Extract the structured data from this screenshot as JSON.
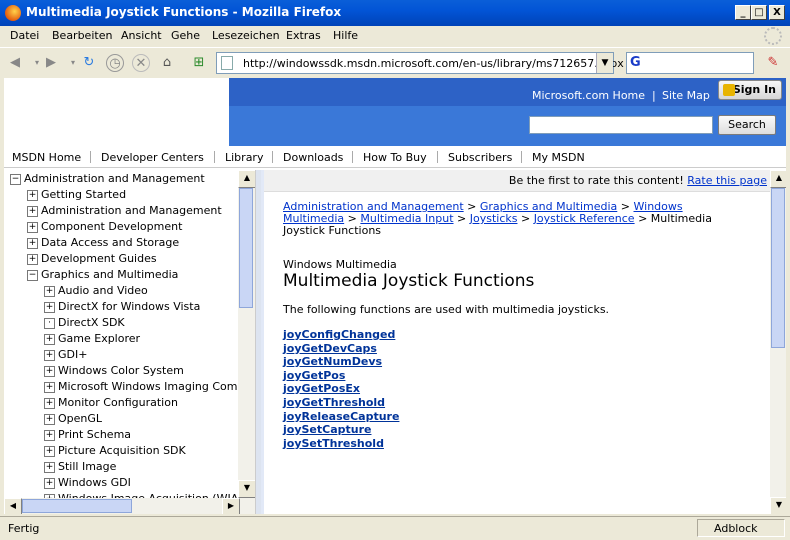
{
  "window": {
    "title": "Multimedia Joystick Functions - Mozilla Firefox",
    "min_label": "_",
    "max_label": "□",
    "close_label": "X"
  },
  "menu": {
    "items": [
      "Datei",
      "Bearbeiten",
      "Ansicht",
      "Gehe",
      "Lesezeichen",
      "Extras",
      "Hilfe"
    ]
  },
  "toolbar": {
    "url": "http://windowssdk.msdn.microsoft.com/en-us/library/ms712657.aspx",
    "search_engine_glyph": "G"
  },
  "header": {
    "link_home": "Microsoft.com Home",
    "link_sep": "|",
    "link_sitemap": "Site Map",
    "signin_label": "Sign In",
    "search_button": "Search",
    "search_value": ""
  },
  "nav": {
    "items": [
      "MSDN Home",
      "Developer Centers",
      "Library",
      "Downloads",
      "How To Buy",
      "Subscribers",
      "My MSDN"
    ]
  },
  "tree": {
    "nodes": [
      {
        "label": "Administration and Management",
        "level": 0,
        "state": "−"
      },
      {
        "label": "Getting Started",
        "level": 1,
        "state": "+"
      },
      {
        "label": "Administration and Management",
        "level": 1,
        "state": "+"
      },
      {
        "label": "Component Development",
        "level": 1,
        "state": "+"
      },
      {
        "label": "Data Access and Storage",
        "level": 1,
        "state": "+"
      },
      {
        "label": "Development Guides",
        "level": 1,
        "state": "+"
      },
      {
        "label": "Graphics and Multimedia",
        "level": 1,
        "state": "−"
      },
      {
        "label": "Audio and Video",
        "level": 2,
        "state": "+"
      },
      {
        "label": "DirectX for Windows Vista",
        "level": 2,
        "state": "+"
      },
      {
        "label": "DirectX SDK",
        "level": 2,
        "state": "·"
      },
      {
        "label": "Game Explorer",
        "level": 2,
        "state": "+"
      },
      {
        "label": "GDI+",
        "level": 2,
        "state": "+"
      },
      {
        "label": "Windows Color System",
        "level": 2,
        "state": "+"
      },
      {
        "label": "Microsoft Windows Imaging Com",
        "level": 2,
        "state": "+"
      },
      {
        "label": "Monitor Configuration",
        "level": 2,
        "state": "+"
      },
      {
        "label": "OpenGL",
        "level": 2,
        "state": "+"
      },
      {
        "label": "Print Schema",
        "level": 2,
        "state": "+"
      },
      {
        "label": "Picture Acquisition SDK",
        "level": 2,
        "state": "+"
      },
      {
        "label": "Still Image",
        "level": 2,
        "state": "+"
      },
      {
        "label": "Windows GDI",
        "level": 2,
        "state": "+"
      },
      {
        "label": "Windows Image Acquisition (WIA",
        "level": 2,
        "state": "+"
      }
    ]
  },
  "content": {
    "rate_text": "Be the first to rate this content!",
    "rate_link": "Rate this page",
    "breadcrumb": {
      "c1": "Administration and Management",
      "sep": ">",
      "c2": "Graphics and Multimedia",
      "c3": "Windows Multimedia",
      "c3a": "Windows",
      "c3b": "Multimedia",
      "c4": "Multimedia Input",
      "c5": "Joysticks",
      "c6": "Joystick Reference",
      "current_a": "Multimedia",
      "current_b": "Joystick Functions"
    },
    "section": "Windows Multimedia",
    "heading": "Multimedia Joystick Functions",
    "intro": "The following functions are used with multimedia joysticks.",
    "functions": [
      "joyConfigChanged",
      "joyGetDevCaps",
      "joyGetNumDevs",
      "joyGetPos",
      "joyGetPosEx",
      "joyGetThreshold",
      "joyReleaseCapture",
      "joySetCapture",
      "joySetThreshold"
    ]
  },
  "status": {
    "text": "Fertig",
    "adblock": "Adblock"
  },
  "colors": {
    "titlebar": "#0254d6",
    "header_blue": "#3a78d8",
    "link": "#0033cc"
  }
}
